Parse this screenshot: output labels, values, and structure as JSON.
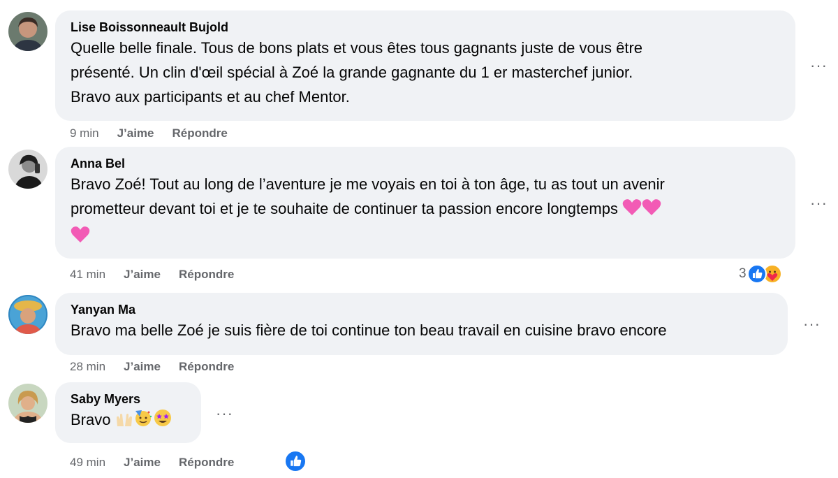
{
  "comments": [
    {
      "author": "Lise Boissonneault Bujold",
      "lines": [
        "Quelle belle finale. Tous de bons plats et vous êtes tous gagnants juste de vous être",
        "présenté. Un clin d'œil spécial à Zoé la grande gagnante du 1 er masterchef junior.",
        "Bravo aux participants et au chef Mentor."
      ],
      "time": "9 min",
      "like_label": "J’aime",
      "reply_label": "Répondre"
    },
    {
      "author": "Anna Bel",
      "lines": [
        "Bravo Zoé! Tout au long de l’aventure je me voyais en toi à ton âge, tu as tout un avenir",
        "prometteur devant toi et je te souhaite de continuer ta passion encore longtemps"
      ],
      "time": "41 min",
      "like_label": "J’aime",
      "reply_label": "Répondre",
      "reaction_count": "3"
    },
    {
      "author": "Yanyan Ma",
      "lines": [
        "Bravo ma belle Zoé je suis fière de toi continue ton beau travail en cuisine bravo encore"
      ],
      "time": "28 min",
      "like_label": "J’aime",
      "reply_label": "Répondre"
    },
    {
      "author": "Saby Myers",
      "lines": [
        "Bravo"
      ],
      "time": "49 min",
      "like_label": "J’aime",
      "reply_label": "Répondre"
    }
  ],
  "more_label": "···",
  "colors": {
    "bubble": "#f0f2f5",
    "meta_text": "#65676b",
    "like_blue": "#1877f2",
    "heart_pink": "#f25bb5"
  },
  "icons": [
    "more-options-icon",
    "pink-heart-emoji",
    "like-reaction-icon",
    "care-reaction-icon",
    "raising-hands-emoji",
    "partying-face-emoji",
    "star-struck-emoji"
  ]
}
